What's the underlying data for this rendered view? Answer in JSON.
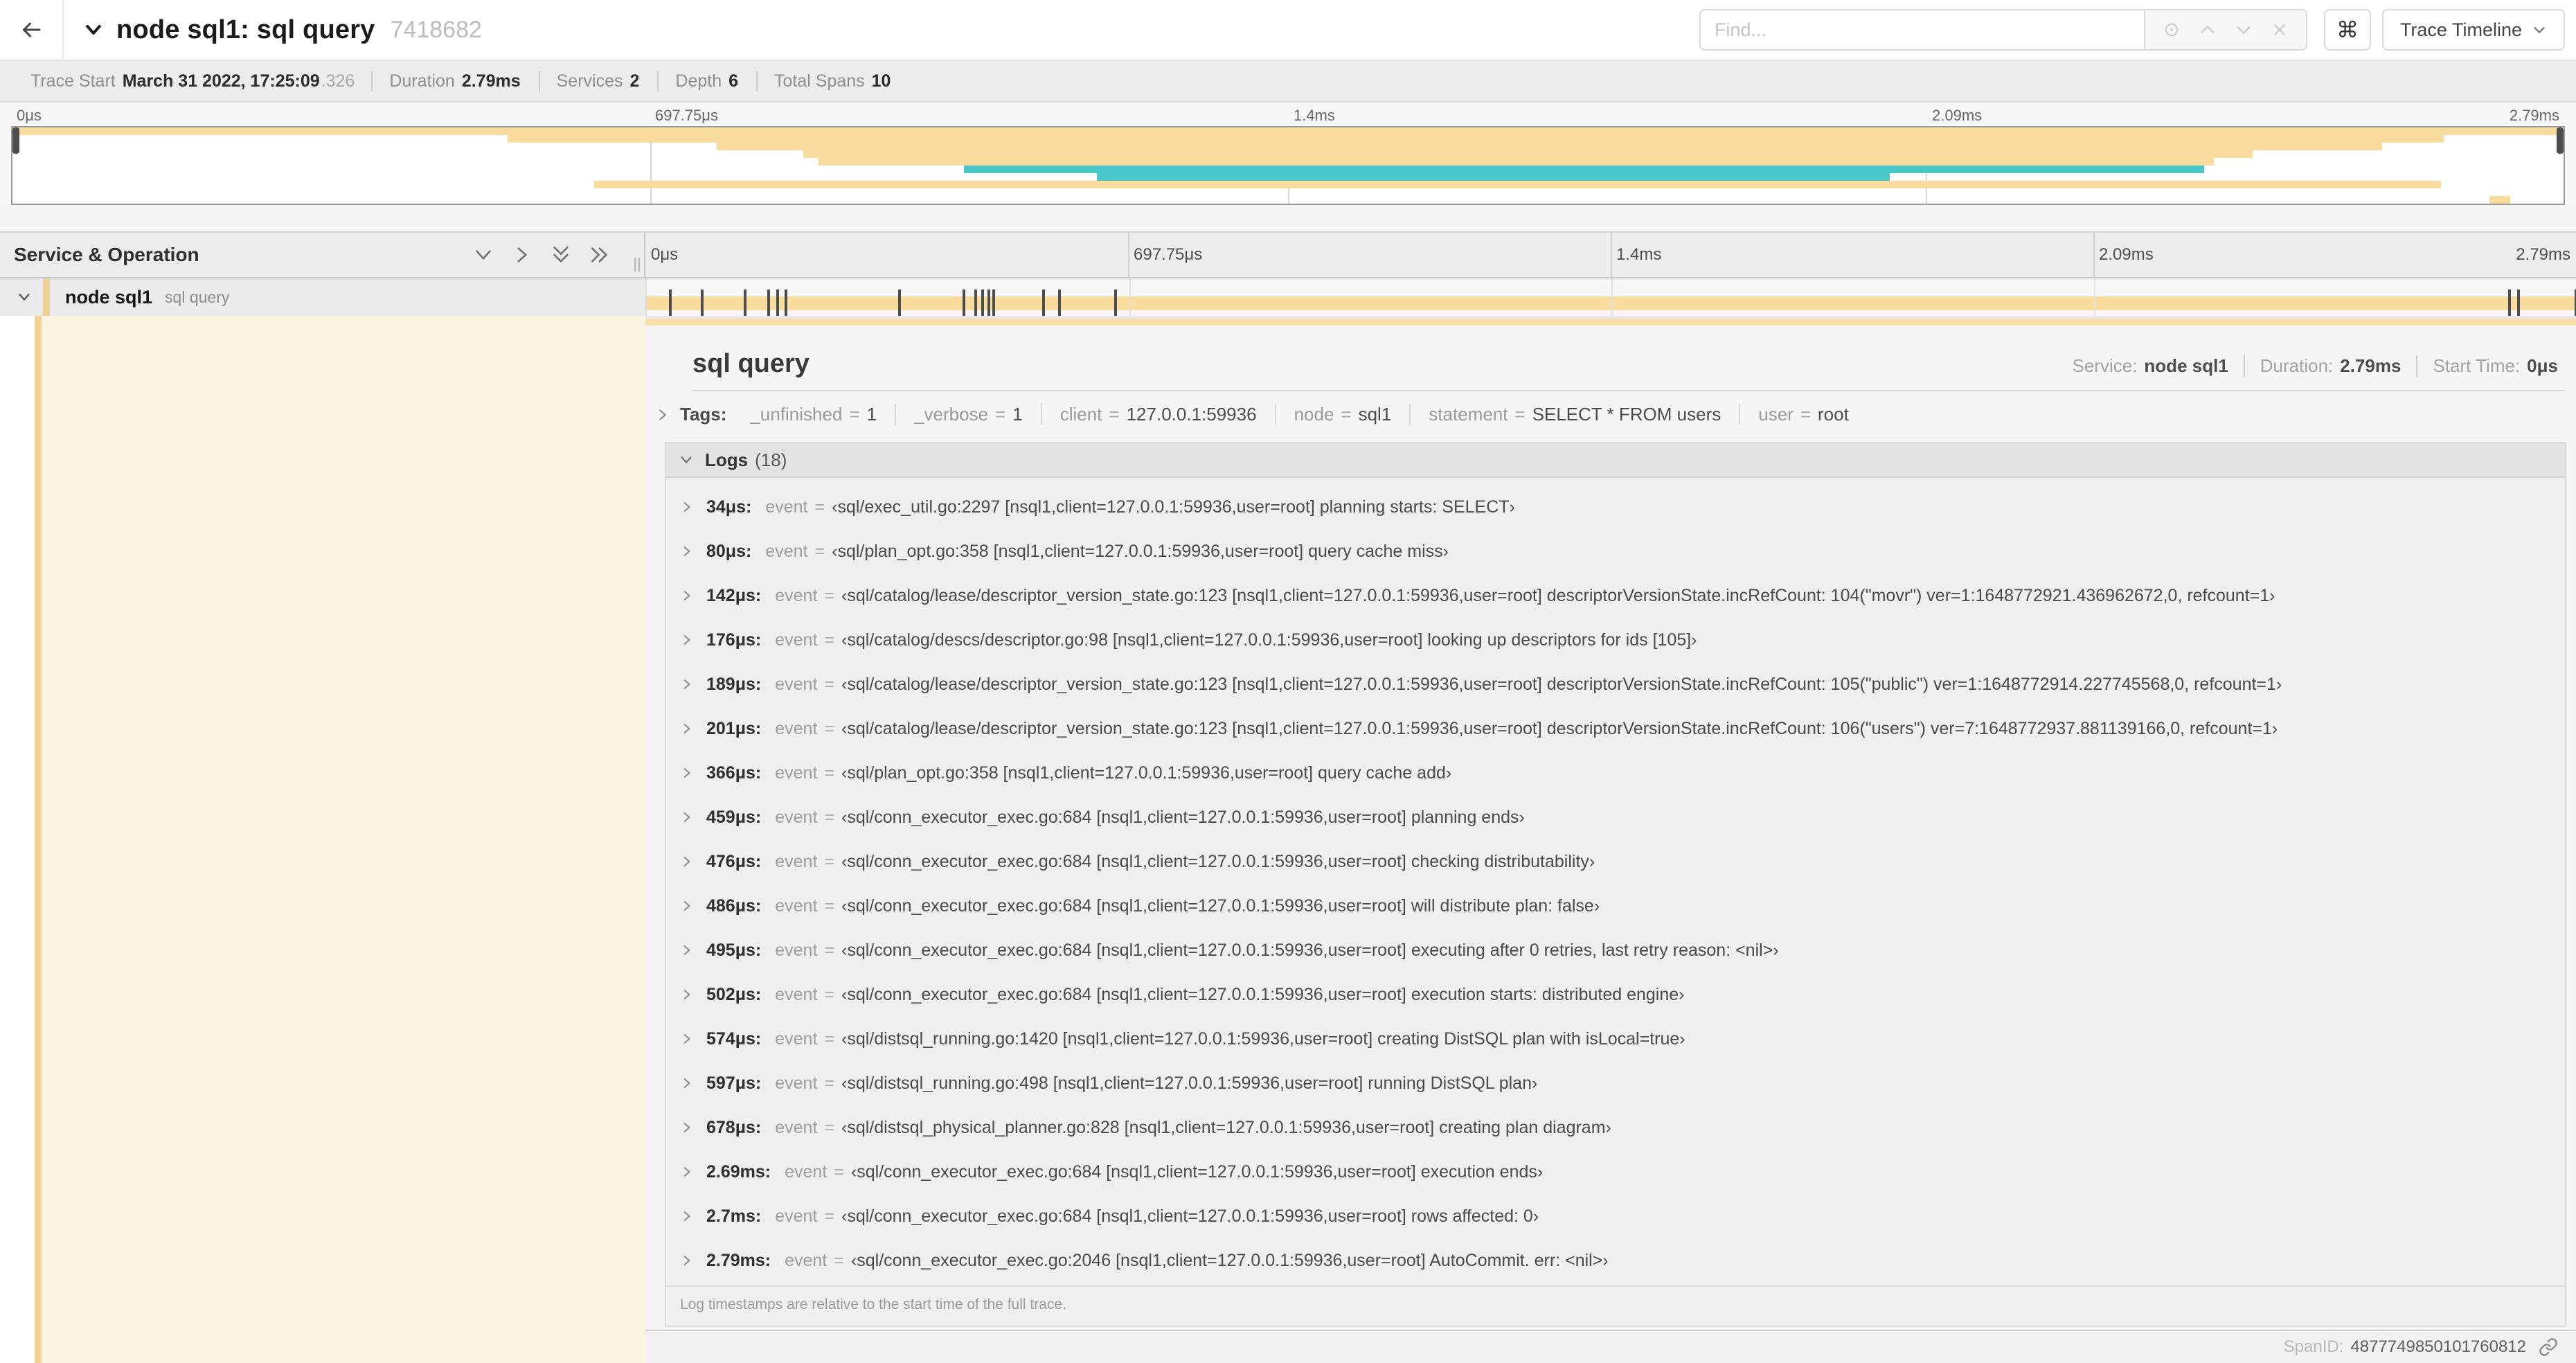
{
  "header": {
    "title": "node sql1: sql query",
    "trace_id_short": "7418682",
    "find_placeholder": "Find...",
    "shortcut_key": "⌘",
    "view_selector": "Trace Timeline"
  },
  "trace_info": {
    "items": [
      {
        "label": "Trace Start",
        "value": "March 31 2022, 17:25:09",
        "suffix": ".326"
      },
      {
        "label": "Duration",
        "value": "2.79ms",
        "suffix": ""
      },
      {
        "label": "Services",
        "value": "2",
        "suffix": ""
      },
      {
        "label": "Depth",
        "value": "6",
        "suffix": ""
      },
      {
        "label": "Total Spans",
        "value": "10",
        "suffix": ""
      }
    ]
  },
  "timeline": {
    "names_header": "Service & Operation",
    "tick_labels": [
      "0μs",
      "697.75μs",
      "1.4ms",
      "2.09ms",
      "2.79ms"
    ],
    "duration_us": 2790
  },
  "minimap": {
    "spans": [
      {
        "row": 0,
        "start": 0,
        "end": 99.9,
        "color": "cream"
      },
      {
        "row": 1,
        "start": 19.4,
        "end": 95.3,
        "color": "cream"
      },
      {
        "row": 2,
        "start": 27.6,
        "end": 92.9,
        "color": "cream"
      },
      {
        "row": 3,
        "start": 31.0,
        "end": 87.8,
        "color": "cream"
      },
      {
        "row": 4,
        "start": 31.6,
        "end": 86.3,
        "color": "cream"
      },
      {
        "row": 5,
        "start": 37.3,
        "end": 85.9,
        "color": "teal"
      },
      {
        "row": 6,
        "start": 42.5,
        "end": 73.6,
        "color": "teal"
      },
      {
        "row": 7,
        "start": 22.8,
        "end": 95.2,
        "color": "cream"
      },
      {
        "row": 9,
        "start": 97.1,
        "end": 97.9,
        "color": "cream"
      }
    ]
  },
  "span_row": {
    "service": "node sql1",
    "operation": "sql query",
    "log_tick_times_us": [
      34,
      80,
      142,
      176,
      189,
      201,
      366,
      459,
      476,
      486,
      495,
      502,
      574,
      597,
      678,
      2694,
      2707,
      2790
    ]
  },
  "detail": {
    "title": "sql query",
    "meta": [
      {
        "label": "Service:",
        "value": "node sql1"
      },
      {
        "label": "Duration:",
        "value": "2.79ms"
      },
      {
        "label": "Start Time:",
        "value": "0μs"
      }
    ],
    "tags": {
      "label": "Tags:",
      "items": [
        {
          "key": "_unfinished",
          "value": "1"
        },
        {
          "key": "_verbose",
          "value": "1"
        },
        {
          "key": "client",
          "value": "127.0.0.1:59936"
        },
        {
          "key": "node",
          "value": "sql1"
        },
        {
          "key": "statement",
          "value": "SELECT * FROM users"
        },
        {
          "key": "user",
          "value": "root"
        }
      ]
    },
    "logs": {
      "label": "Logs",
      "count": "(18)",
      "entries": [
        {
          "time": "34μs:",
          "key": "event",
          "value": "‹sql/exec_util.go:2297 [nsql1,client=127.0.0.1:59936,user=root] planning starts: SELECT›"
        },
        {
          "time": "80μs:",
          "key": "event",
          "value": "‹sql/plan_opt.go:358 [nsql1,client=127.0.0.1:59936,user=root] query cache miss›"
        },
        {
          "time": "142μs:",
          "key": "event",
          "value": "‹sql/catalog/lease/descriptor_version_state.go:123 [nsql1,client=127.0.0.1:59936,user=root] descriptorVersionState.incRefCount: 104(\"movr\") ver=1:1648772921.436962672,0, refcount=1›"
        },
        {
          "time": "176μs:",
          "key": "event",
          "value": "‹sql/catalog/descs/descriptor.go:98 [nsql1,client=127.0.0.1:59936,user=root] looking up descriptors for ids [105]›"
        },
        {
          "time": "189μs:",
          "key": "event",
          "value": "‹sql/catalog/lease/descriptor_version_state.go:123 [nsql1,client=127.0.0.1:59936,user=root] descriptorVersionState.incRefCount: 105(\"public\") ver=1:1648772914.227745568,0, refcount=1›"
        },
        {
          "time": "201μs:",
          "key": "event",
          "value": "‹sql/catalog/lease/descriptor_version_state.go:123 [nsql1,client=127.0.0.1:59936,user=root] descriptorVersionState.incRefCount: 106(\"users\") ver=7:1648772937.881139166,0, refcount=1›"
        },
        {
          "time": "366μs:",
          "key": "event",
          "value": "‹sql/plan_opt.go:358 [nsql1,client=127.0.0.1:59936,user=root] query cache add›"
        },
        {
          "time": "459μs:",
          "key": "event",
          "value": "‹sql/conn_executor_exec.go:684 [nsql1,client=127.0.0.1:59936,user=root] planning ends›"
        },
        {
          "time": "476μs:",
          "key": "event",
          "value": "‹sql/conn_executor_exec.go:684 [nsql1,client=127.0.0.1:59936,user=root] checking distributability›"
        },
        {
          "time": "486μs:",
          "key": "event",
          "value": "‹sql/conn_executor_exec.go:684 [nsql1,client=127.0.0.1:59936,user=root] will distribute plan: false›"
        },
        {
          "time": "495μs:",
          "key": "event",
          "value": "‹sql/conn_executor_exec.go:684 [nsql1,client=127.0.0.1:59936,user=root] executing after 0 retries, last retry reason: <nil>›"
        },
        {
          "time": "502μs:",
          "key": "event",
          "value": "‹sql/conn_executor_exec.go:684 [nsql1,client=127.0.0.1:59936,user=root] execution starts: distributed engine›"
        },
        {
          "time": "574μs:",
          "key": "event",
          "value": "‹sql/distsql_running.go:1420 [nsql1,client=127.0.0.1:59936,user=root] creating DistSQL plan with isLocal=true›"
        },
        {
          "time": "597μs:",
          "key": "event",
          "value": "‹sql/distsql_running.go:498 [nsql1,client=127.0.0.1:59936,user=root] running DistSQL plan›"
        },
        {
          "time": "678μs:",
          "key": "event",
          "value": "‹sql/distsql_physical_planner.go:828 [nsql1,client=127.0.0.1:59936,user=root] creating plan diagram›"
        },
        {
          "time": "2.69ms:",
          "key": "event",
          "value": "‹sql/conn_executor_exec.go:684 [nsql1,client=127.0.0.1:59936,user=root] execution ends›"
        },
        {
          "time": "2.7ms:",
          "key": "event",
          "value": "‹sql/conn_executor_exec.go:684 [nsql1,client=127.0.0.1:59936,user=root] rows affected: 0›"
        },
        {
          "time": "2.79ms:",
          "key": "event",
          "value": "‹sql/conn_executor_exec.go:2046 [nsql1,client=127.0.0.1:59936,user=root] AutoCommit. err: <nil>›"
        }
      ],
      "footnote": "Log timestamps are relative to the start time of the full trace."
    },
    "footer": {
      "label": "SpanID:",
      "value": "4877749850101760812"
    }
  },
  "symbols": {
    "eq": "="
  },
  "colors": {
    "cream": "#f8dc9e",
    "teal": "#49c6c8",
    "cream_pale": "#fbf4e2",
    "cream_accent": "#f1d195"
  }
}
